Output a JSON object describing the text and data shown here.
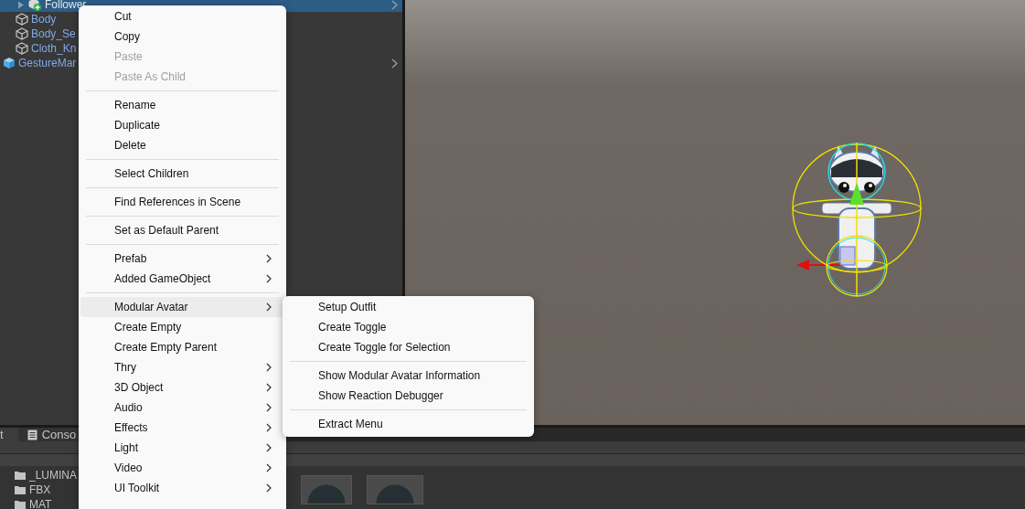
{
  "hierarchy": {
    "rows": [
      {
        "label": "Follower",
        "kind": "added",
        "selected": true,
        "foldout": true,
        "chevron": true
      },
      {
        "label": "Body",
        "kind": "object",
        "selected": false,
        "foldout": false,
        "chevron": false
      },
      {
        "label": "Body_Se",
        "kind": "object",
        "selected": false,
        "foldout": false,
        "chevron": false
      },
      {
        "label": "Cloth_Kn",
        "kind": "object",
        "selected": false,
        "foldout": false,
        "chevron": false
      },
      {
        "label": "GestureMar",
        "kind": "prefab",
        "selected": false,
        "foldout": false,
        "chevron": true
      }
    ]
  },
  "bottom_panel": {
    "tabs": [
      {
        "label": "t",
        "selected": true,
        "icon": false
      },
      {
        "label": "Conso",
        "selected": false,
        "icon": true
      }
    ],
    "folders": [
      "_LUMINA",
      "FBX",
      "MAT"
    ]
  },
  "context_menu": {
    "items": [
      {
        "kind": "item",
        "label": "Cut",
        "disabled": false,
        "submenu": false,
        "selected": false
      },
      {
        "kind": "item",
        "label": "Copy",
        "disabled": false,
        "submenu": false,
        "selected": false
      },
      {
        "kind": "item",
        "label": "Paste",
        "disabled": true,
        "submenu": false,
        "selected": false
      },
      {
        "kind": "item",
        "label": "Paste As Child",
        "disabled": true,
        "submenu": false,
        "selected": false
      },
      {
        "kind": "separator"
      },
      {
        "kind": "item",
        "label": "Rename",
        "disabled": false,
        "submenu": false,
        "selected": false
      },
      {
        "kind": "item",
        "label": "Duplicate",
        "disabled": false,
        "submenu": false,
        "selected": false
      },
      {
        "kind": "item",
        "label": "Delete",
        "disabled": false,
        "submenu": false,
        "selected": false
      },
      {
        "kind": "separator"
      },
      {
        "kind": "item",
        "label": "Select Children",
        "disabled": false,
        "submenu": false,
        "selected": false
      },
      {
        "kind": "separator"
      },
      {
        "kind": "item",
        "label": "Find References in Scene",
        "disabled": false,
        "submenu": false,
        "selected": false
      },
      {
        "kind": "separator"
      },
      {
        "kind": "item",
        "label": "Set as Default Parent",
        "disabled": false,
        "submenu": false,
        "selected": false
      },
      {
        "kind": "separator"
      },
      {
        "kind": "item",
        "label": "Prefab",
        "disabled": false,
        "submenu": true,
        "selected": false
      },
      {
        "kind": "item",
        "label": "Added GameObject",
        "disabled": false,
        "submenu": true,
        "selected": false
      },
      {
        "kind": "separator"
      },
      {
        "kind": "item",
        "label": "Modular Avatar",
        "disabled": false,
        "submenu": true,
        "selected": true
      },
      {
        "kind": "item",
        "label": "Create Empty",
        "disabled": false,
        "submenu": false,
        "selected": false
      },
      {
        "kind": "item",
        "label": "Create Empty Parent",
        "disabled": false,
        "submenu": false,
        "selected": false
      },
      {
        "kind": "item",
        "label": "Thry",
        "disabled": false,
        "submenu": true,
        "selected": false
      },
      {
        "kind": "item",
        "label": "3D Object",
        "disabled": false,
        "submenu": true,
        "selected": false
      },
      {
        "kind": "item",
        "label": "Audio",
        "disabled": false,
        "submenu": true,
        "selected": false
      },
      {
        "kind": "item",
        "label": "Effects",
        "disabled": false,
        "submenu": true,
        "selected": false
      },
      {
        "kind": "item",
        "label": "Light",
        "disabled": false,
        "submenu": true,
        "selected": false
      },
      {
        "kind": "item",
        "label": "Video",
        "disabled": false,
        "submenu": true,
        "selected": false
      },
      {
        "kind": "item",
        "label": "UI Toolkit",
        "disabled": false,
        "submenu": true,
        "selected": false
      }
    ]
  },
  "submenu": {
    "items": [
      {
        "kind": "item",
        "label": "Setup Outfit"
      },
      {
        "kind": "item",
        "label": "Create Toggle"
      },
      {
        "kind": "item",
        "label": "Create Toggle for Selection"
      },
      {
        "kind": "separator"
      },
      {
        "kind": "item",
        "label": "Show Modular Avatar Information"
      },
      {
        "kind": "item",
        "label": "Show Reaction Debugger"
      },
      {
        "kind": "separator"
      },
      {
        "kind": "item",
        "label": "Extract Menu"
      }
    ]
  }
}
